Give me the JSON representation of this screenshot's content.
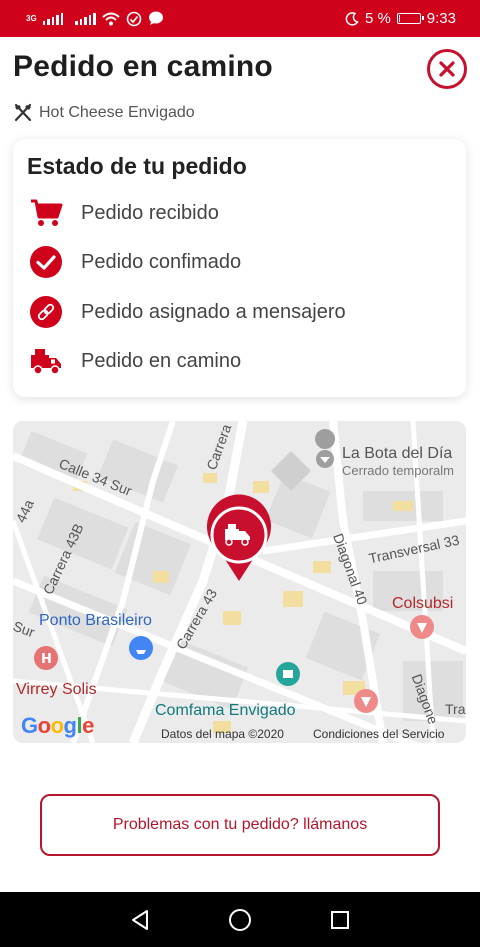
{
  "status_bar": {
    "network_label": "3G",
    "battery_text": "5 %",
    "battery_level": 0.05,
    "time": "9:33"
  },
  "header": {
    "title": "Pedido en camino",
    "restaurant": "Hot Cheese Envigado"
  },
  "order_status": {
    "title": "Estado de tu pedido",
    "steps": [
      {
        "label": "Pedido recibido",
        "icon": "cart-icon"
      },
      {
        "label": "Pedido confimado",
        "icon": "check-circle-icon"
      },
      {
        "label": "Pedido asignado a mensajero",
        "icon": "link-icon"
      },
      {
        "label": "Pedido en camino",
        "icon": "delivery-truck-icon"
      }
    ]
  },
  "map": {
    "labels": {
      "carrera_top": "Carrera",
      "calle_34_sur": "Calle 34 Sur",
      "carrera_43b": "Carrera 43B",
      "carrera_44a": "44a",
      "la_bota": "La Bota del Día",
      "cerrado": "Cerrado temporalm",
      "transversal_33": "Transversal 33",
      "diagonal_40": "Diagonal 40",
      "colsubsidio": "Colsubsi",
      "ponto_brasileiro": "Ponto Brasileiro",
      "carrera_43": "Carrera 43",
      "sur": "Sur",
      "virrey_solis": "Virrey Solis",
      "comfama": "Comfama Envigado",
      "diagonal": "Diagone",
      "tra": "Tra"
    },
    "google_logo": "Google",
    "data_credit": "Datos del mapa ©2020",
    "terms": "Condiciones del Servicio"
  },
  "call_button": "Problemas con tu pedido? llámanos",
  "colors": {
    "brand_red": "#d0021b",
    "accent_red": "#c8102e"
  }
}
